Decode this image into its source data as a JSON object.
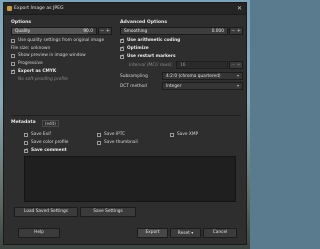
{
  "window": {
    "title": "Export Image as JPEG"
  },
  "options": {
    "header": "Options",
    "quality_label": "Quality",
    "quality_value": "90.0",
    "quality_level": 0.9,
    "use_quality_from_original": "Use quality settings from original image",
    "file_size_unknown": "File size: unknown",
    "show_preview": "Show preview in image window",
    "progressive": "Progressive",
    "export_as_cmyk": "Export as CMYK",
    "no_soft_proofing": "No soft-proofing profile"
  },
  "advanced": {
    "header": "Advanced Options",
    "smoothing_label": "Smoothing",
    "smoothing_value": "0.000",
    "use_arithmetic": "Use arithmetic coding",
    "optimize": "Optimize",
    "use_restart_markers": "Use restart markers",
    "interval_label": "Interval (MCU rows):",
    "interval_value": "16",
    "subsampling_label": "Subsampling",
    "subsampling_value": "4:2:0 (chroma quartered)",
    "dct_label": "DCT method",
    "dct_value": "Integer"
  },
  "metadata": {
    "header": "Metadata",
    "edit_label": "(edit)",
    "save_exif": "Save Exif",
    "save_xmp": "Save XMP",
    "save_iptc": "Save IPTC",
    "save_thumbnail": "Save thumbnail",
    "save_color_profile": "Save color profile",
    "save_comment": "Save comment"
  },
  "buttons": {
    "load_defaults": "Load Saved Settings",
    "save_defaults": "Save Settings",
    "help": "Help",
    "export": "Export",
    "reset": "Reset",
    "cancel": "Cancel"
  }
}
